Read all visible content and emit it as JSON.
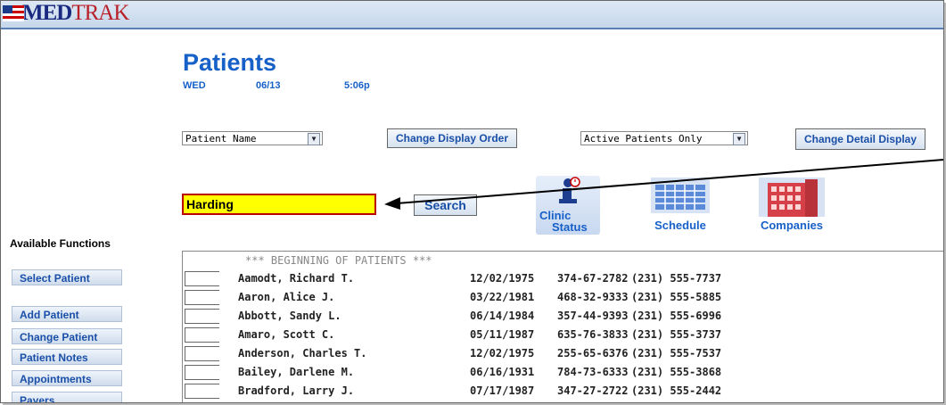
{
  "app": {
    "logo_text": "TRAK",
    "logo_prefix": "MED"
  },
  "page": {
    "title": "Patients",
    "day": "WED",
    "date": "06/13",
    "time": "5:06p"
  },
  "controls": {
    "sort_select": "Patient Name",
    "change_order_label": "Change Display Order",
    "filter_select": "Active Patients Only",
    "change_detail_label": "Change Detail Display"
  },
  "search": {
    "value": "Harding",
    "button_label": "Search"
  },
  "shortcuts": [
    {
      "label_line1": "Clinic",
      "label_line2": "Status"
    },
    {
      "label_line1": "Schedule",
      "label_line2": ""
    },
    {
      "label_line1": "Companies",
      "label_line2": ""
    }
  ],
  "sidebar": {
    "heading": "Available Functions",
    "items": [
      "Select Patient",
      "Add Patient",
      "Change Patient",
      "Patient Notes",
      "Appointments",
      "Payers"
    ]
  },
  "list": {
    "header": "*** BEGINNING OF PATIENTS ***",
    "rows": [
      {
        "name": "Aamodt, Richard T.",
        "dob": "12/02/1975",
        "ssn": "374-67-2782",
        "phone": "(231) 555-7737"
      },
      {
        "name": "Aaron, Alice J.",
        "dob": "03/22/1981",
        "ssn": "468-32-9333",
        "phone": "(231) 555-5885"
      },
      {
        "name": "Abbott, Sandy L.",
        "dob": "06/14/1984",
        "ssn": "357-44-9393",
        "phone": "(231) 555-6996"
      },
      {
        "name": "Amaro, Scott C.",
        "dob": "05/11/1987",
        "ssn": "635-76-3833",
        "phone": "(231) 555-3737"
      },
      {
        "name": "Anderson, Charles T.",
        "dob": "12/02/1975",
        "ssn": "255-65-6376",
        "phone": "(231) 555-7537"
      },
      {
        "name": "Bailey, Darlene M.",
        "dob": "06/16/1931",
        "ssn": "784-73-6333",
        "phone": "(231) 555-3868"
      },
      {
        "name": "Bradford, Larry J.",
        "dob": "07/17/1987",
        "ssn": "347-27-2722",
        "phone": "(231) 555-2442"
      }
    ]
  }
}
